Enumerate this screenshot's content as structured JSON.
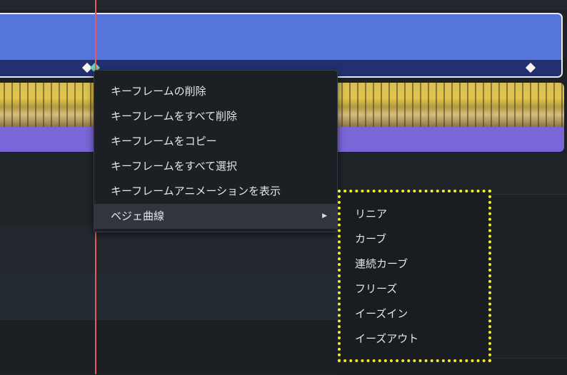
{
  "context_menu": {
    "items": [
      {
        "label": "キーフレームの削除"
      },
      {
        "label": "キーフレームをすべて削除"
      },
      {
        "label": "キーフレームをコピー"
      },
      {
        "label": "キーフレームをすべて選択"
      },
      {
        "label": "キーフレームアニメーションを表示"
      },
      {
        "label": "ベジェ曲線",
        "has_submenu": true,
        "arrow": "▶"
      }
    ]
  },
  "bezier_submenu": {
    "items": [
      {
        "label": "リニア"
      },
      {
        "label": "カーブ"
      },
      {
        "label": "連続カーブ"
      },
      {
        "label": "フリーズ"
      },
      {
        "label": "イーズイン"
      },
      {
        "label": "イーズアウト"
      }
    ]
  },
  "colors": {
    "playhead": "#e85b5b",
    "clip_blue": "#5574dc",
    "clip_video": "#7a66d6",
    "highlight": "#f5ee2a",
    "menu_bg": "#1c2024"
  }
}
